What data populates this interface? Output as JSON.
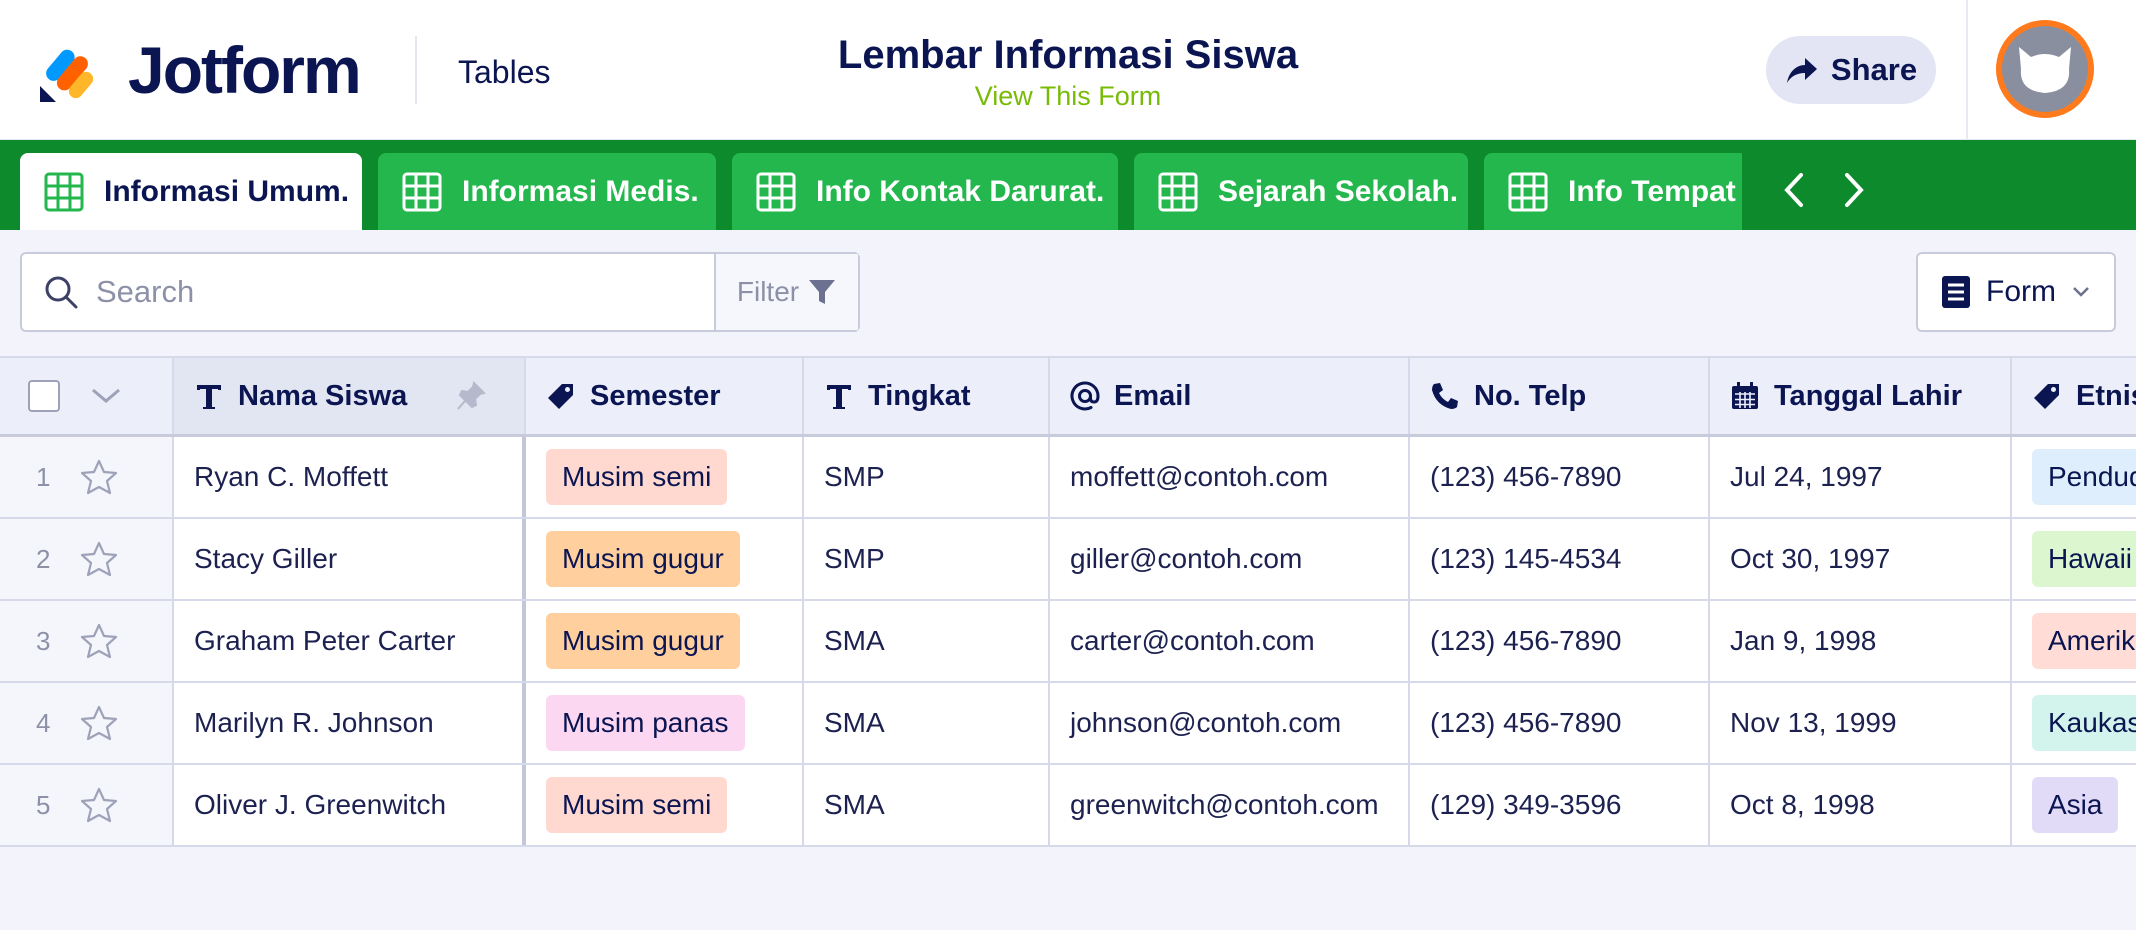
{
  "header": {
    "logo_text": "Jotform",
    "section_label": "Tables",
    "form_title": "Lembar Informasi Siswa",
    "form_link": "View This Form",
    "share_label": "Share"
  },
  "tabs": [
    {
      "label": "Informasi Umum.",
      "active": true
    },
    {
      "label": "Informasi Medis.",
      "active": false
    },
    {
      "label": "Info Kontak Darurat.",
      "active": false
    },
    {
      "label": "Sejarah Sekolah.",
      "active": false
    },
    {
      "label": "Info Tempat Tinggal.",
      "active": false
    }
  ],
  "toolbar": {
    "search_placeholder": "Search",
    "filter_label": "Filter",
    "view_label": "Form"
  },
  "columns": [
    "Nama Siswa",
    "Semester",
    "Tingkat",
    "Email",
    "No. Telp",
    "Tanggal Lahir",
    "Etnisitas"
  ],
  "rows": [
    {
      "num": "1",
      "name": "Ryan C. Moffett",
      "semester": "Musim semi",
      "tingkat": "SMP",
      "email": "moffett@contoh.com",
      "phone": "(123) 456-7890",
      "dob": "Jul 24, 1997",
      "etnis": "Penduduk Asli"
    },
    {
      "num": "2",
      "name": "Stacy Giller",
      "semester": "Musim gugur",
      "tingkat": "SMP",
      "email": "giller@contoh.com",
      "phone": "(123) 145-4534",
      "dob": "Oct 30, 1997",
      "etnis": "Hawaii"
    },
    {
      "num": "3",
      "name": "Graham Peter Carter",
      "semester": "Musim gugur",
      "tingkat": "SMA",
      "email": "carter@contoh.com",
      "phone": "(123) 456-7890",
      "dob": "Jan 9, 1998",
      "etnis": "Amerika"
    },
    {
      "num": "4",
      "name": "Marilyn R. Johnson",
      "semester": "Musim panas",
      "tingkat": "SMA",
      "email": "johnson@contoh.com",
      "phone": "(123) 456-7890",
      "dob": "Nov 13, 1999",
      "etnis": "Kaukasia"
    },
    {
      "num": "5",
      "name": "Oliver J. Greenwitch",
      "semester": "Musim semi",
      "tingkat": "SMA",
      "email": "greenwitch@contoh.com",
      "phone": "(129) 349-3596",
      "dob": "Oct 8, 1998",
      "etnis": "Asia"
    }
  ],
  "colors": {
    "brand_navy": "#0a1551",
    "tab_bar": "#0d8a2c",
    "tab": "#23b74d",
    "link_green": "#78bb07",
    "tag_musim_semi": "#ffd9d0",
    "tag_musim_gugur": "#ffcf9e",
    "tag_musim_panas": "#fbd7f1",
    "tag_penduduk_asli": "#dfeefc",
    "tag_hawaii": "#dcf6cf",
    "tag_amerika": "#ffdcd6",
    "tag_kaukasia": "#d2f4ec",
    "tag_asia": "#e2dbf8"
  },
  "icons": {
    "logo": "jotform-pencil-logo",
    "share": "share-arrow-icon",
    "tab": "grid-table-icon",
    "search": "search-icon",
    "filter": "funnel-icon",
    "view": "form-list-icon",
    "text_col": "text-t-icon",
    "tag_col": "tag-icon",
    "email_col": "at-icon",
    "phone_col": "phone-icon",
    "date_col": "calendar-icon",
    "row": "star-icon"
  }
}
